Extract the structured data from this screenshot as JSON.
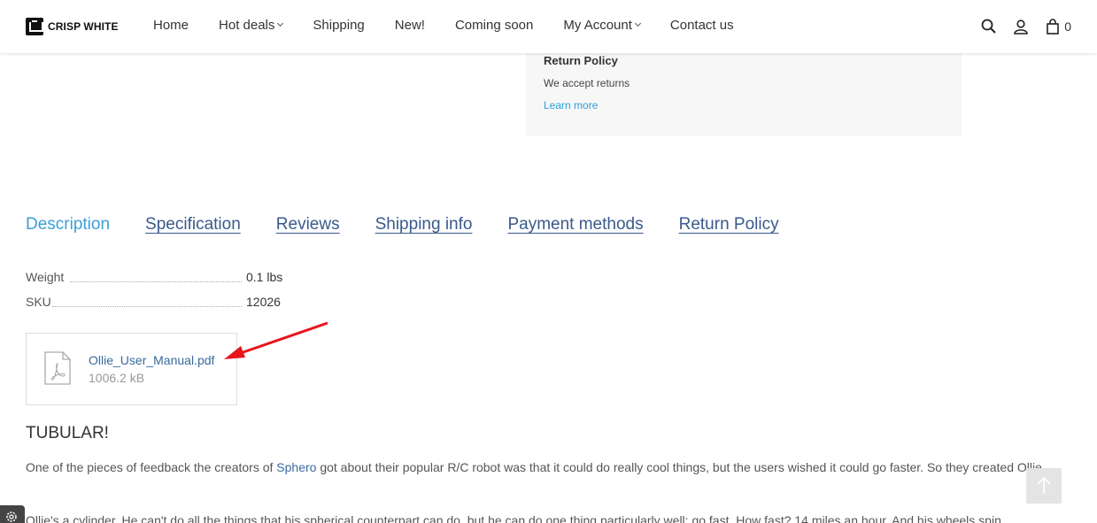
{
  "header": {
    "logo_text": "CRISP WHITE",
    "nav": [
      {
        "label": "Home"
      },
      {
        "label": "Hot deals"
      },
      {
        "label": "Shipping"
      },
      {
        "label": "New!"
      },
      {
        "label": "Coming soon"
      },
      {
        "label": "My Account"
      },
      {
        "label": "Contact us"
      }
    ],
    "cart_count": "0",
    "icons": [
      "search-icon",
      "user-icon",
      "cart-icon"
    ]
  },
  "policy": {
    "title": "Return Policy",
    "text": "We accept returns",
    "link": "Learn more"
  },
  "tabs": [
    {
      "label": "Description",
      "active": true
    },
    {
      "label": "Specification"
    },
    {
      "label": "Reviews"
    },
    {
      "label": "Shipping info"
    },
    {
      "label": "Payment methods"
    },
    {
      "label": "Return Policy"
    }
  ],
  "specs": [
    {
      "label": "Weight",
      "value": "0.1 lbs"
    },
    {
      "label": "SKU",
      "value": "12026"
    }
  ],
  "attachment": {
    "name": "Ollie_User_Manual.pdf",
    "size": "1006.2 kB",
    "icon": "pdf-icon"
  },
  "description": {
    "title": "TUBULAR!",
    "p1_before": "One of the pieces of feedback the creators of ",
    "p1_link": "Sphero",
    "p1_after": " got about their popular R/C robot was that it could do really cool things, but the users wished it could go faster. So they created Ollie.",
    "p2": "Ollie's a cylinder. He can't do all the things that his spherical counterpart can do, but he can do one thing particularly well: go fast. How fast? 14 miles an hour. And his wheels spin"
  },
  "colors": {
    "accent": "#3d9fd6",
    "link": "#3a6aa0",
    "arrow": "#e8141b"
  }
}
